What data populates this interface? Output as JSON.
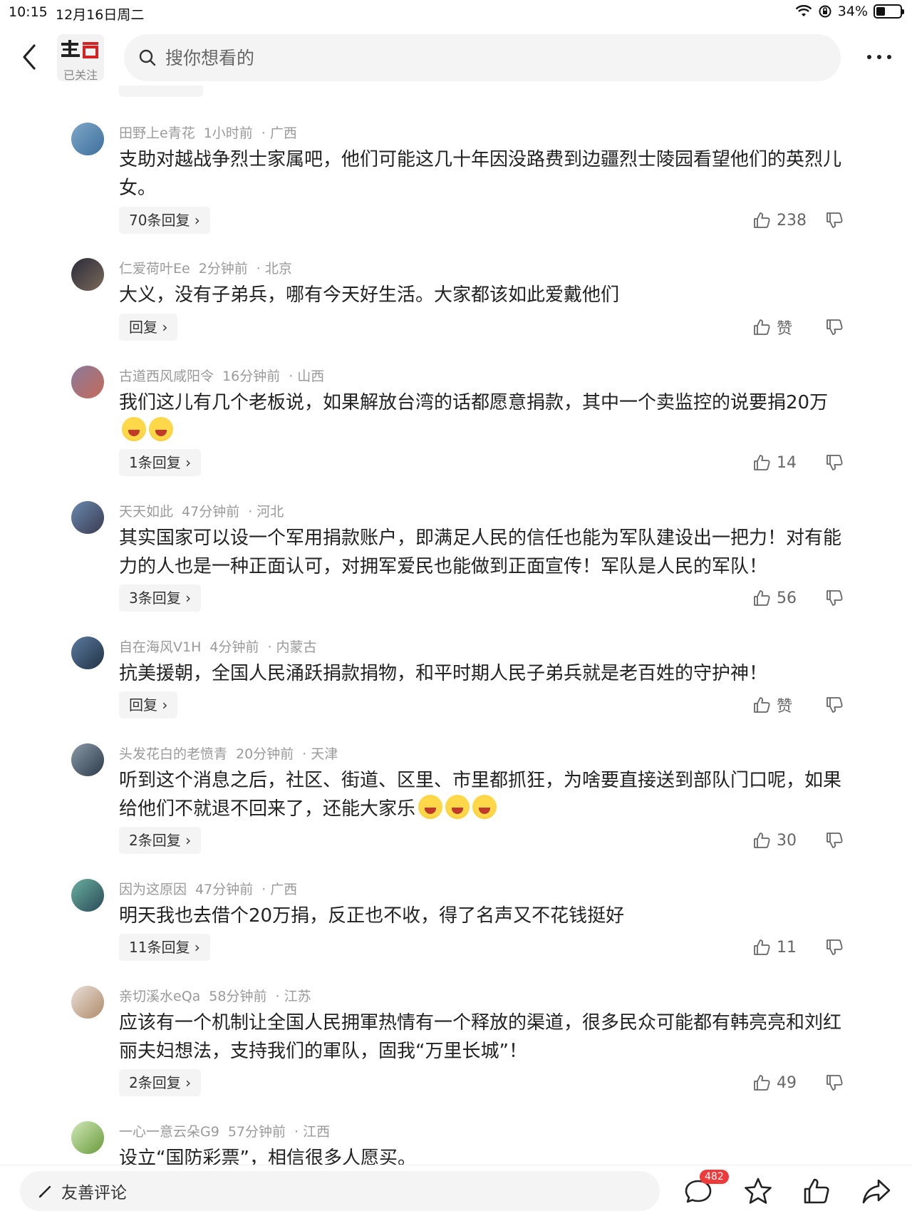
{
  "status_bar": {
    "time": "10:15",
    "date": "12月16日周二",
    "battery": "34%",
    "battery_level": 0.34
  },
  "header": {
    "followed_label": "已关注",
    "search_placeholder": "搜你想看的"
  },
  "comments": [
    {
      "user": "田野上e青花",
      "time": "1小时前",
      "region": "· 广西",
      "text": "支助对越战争烈士家属吧，他们可能这几十年因没路费到边疆烈士陵园看望他们的英烈儿女。",
      "reply": "70条回复 ›",
      "likes": "238"
    },
    {
      "user": "仁爱荷叶Ee",
      "time": "2分钟前",
      "region": "· 北京",
      "text": "大义，没有子弟兵，哪有今天好生活。大家都该如此爱戴他们",
      "reply": "回复 ›",
      "likes": "赞"
    },
    {
      "user": "古道西风咸阳令",
      "time": "16分钟前",
      "region": "· 山西",
      "text": "我们这儿有几个老板说，如果解放台湾的话都愿意捐款，其中一个卖监控的说要捐20万",
      "reply": "1条回复 ›",
      "likes": "14",
      "emoji_count": 2
    },
    {
      "user": "天天如此",
      "time": "47分钟前",
      "region": "· 河北",
      "text": "其实国家可以设一个军用捐款账户，即满足人民的信任也能为军队建设出一把力！对有能力的人也是一种正面认可，对拥军爱民也能做到正面宣传！军队是人民的军队！",
      "reply": "3条回复 ›",
      "likes": "56"
    },
    {
      "user": "自在海风V1H",
      "time": "4分钟前",
      "region": "· 内蒙古",
      "text": "抗美援朝，全国人民涌跃捐款捐物，和平时期人民子弟兵就是老百姓的守护神！",
      "reply": "回复 ›",
      "likes": "赞"
    },
    {
      "user": "头发花白的老愤青",
      "time": "20分钟前",
      "region": "· 天津",
      "text": "听到这个消息之后，社区、街道、区里、市里都抓狂，为啥要直接送到部队门口呢，如果给他们不就退不回来了，还能大家乐",
      "reply": "2条回复 ›",
      "likes": "30",
      "emoji_count": 3
    },
    {
      "user": "因为这原因",
      "time": "47分钟前",
      "region": "· 广西",
      "text": "明天我也去借个20万捐，反正也不收，得了名声又不花钱挺好",
      "reply": "11条回复 ›",
      "likes": "11"
    },
    {
      "user": "亲切溪水eQa",
      "time": "58分钟前",
      "region": "· 江苏",
      "text": "应该有一个机制让全国人民拥軍热情有一个释放的渠道，很多民众可能都有韩亮亮和刘红丽夫妇想法，支持我们的軍队，固我“万里长城”！",
      "reply": "2条回复 ›",
      "likes": "49"
    },
    {
      "user": "一心一意云朵G9",
      "time": "57分钟前",
      "region": "· 江西",
      "text": "设立“国防彩票”，相信很多人愿买。"
    }
  ],
  "bottom_bar": {
    "input_label": "友善评论",
    "comment_count": "482"
  },
  "colors": {
    "badge": "#ee3a3a",
    "search_bg": "#f4f4f4",
    "meta_text": "#9a9a9a"
  },
  "icons": [
    "back-arrow-icon",
    "search-icon",
    "more-icon",
    "thumbs-up-icon",
    "thumbs-down-icon",
    "pen-icon",
    "comment-icon",
    "star-icon",
    "share-icon"
  ]
}
